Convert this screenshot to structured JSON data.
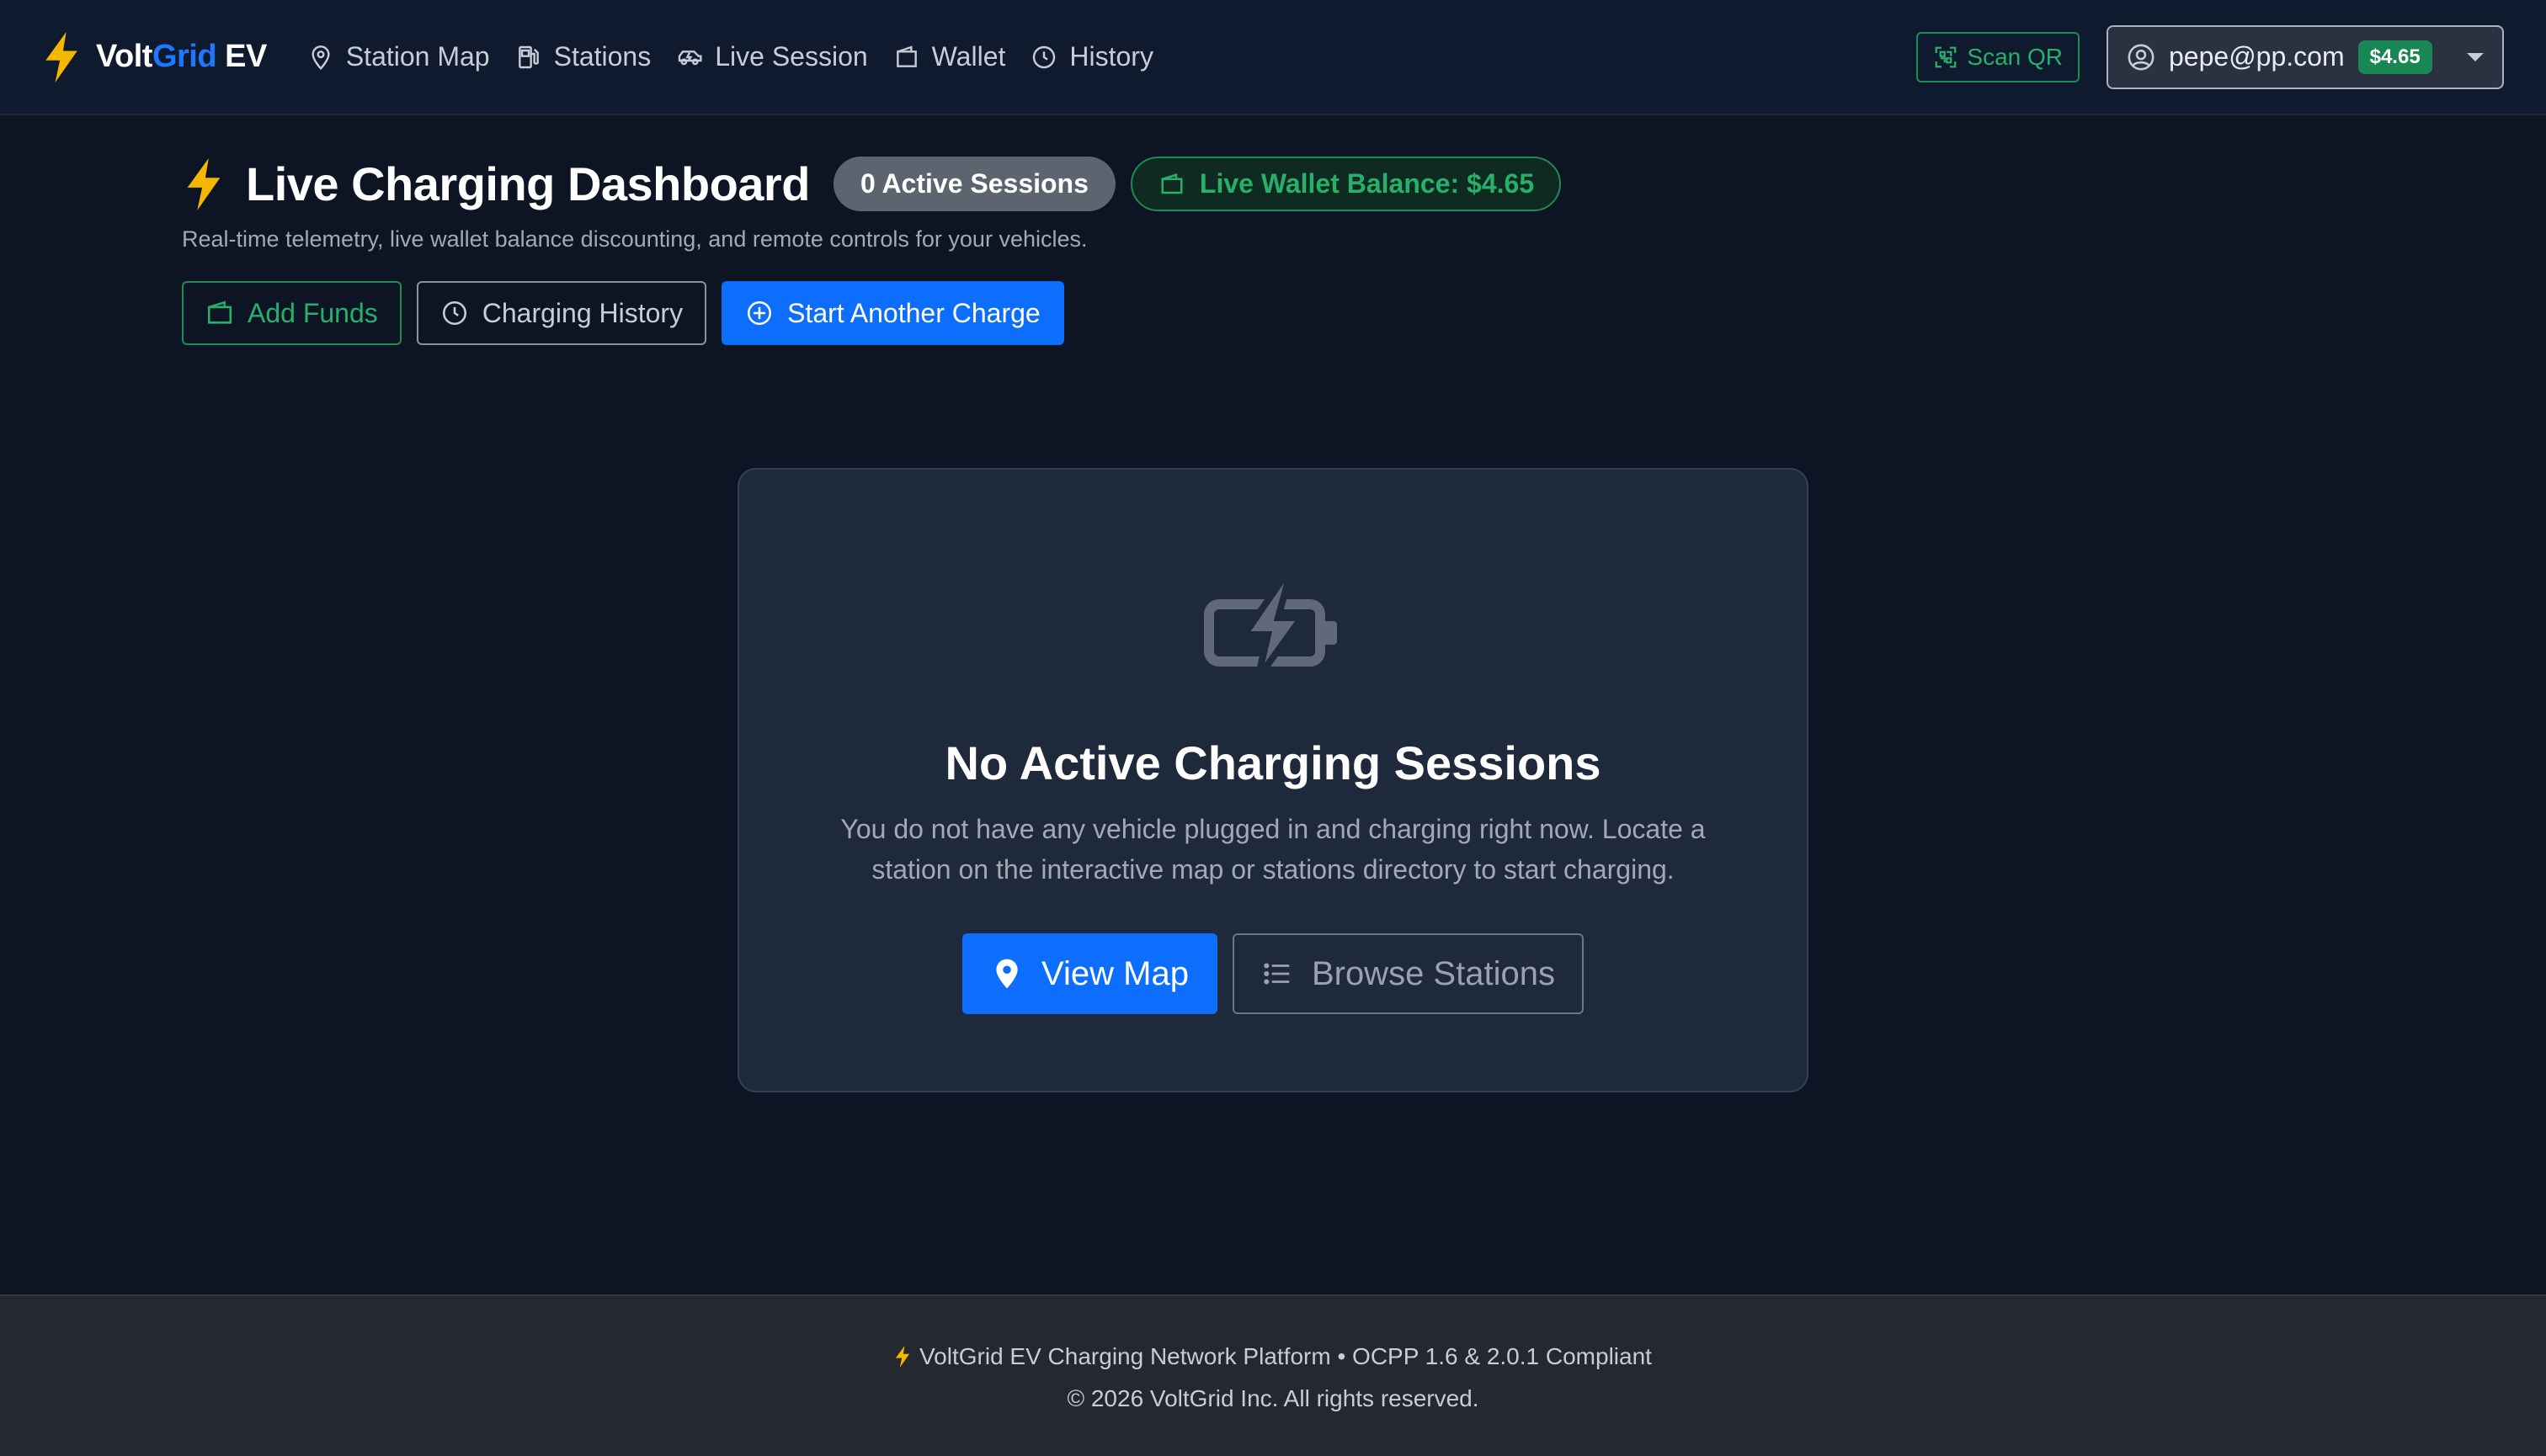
{
  "colors": {
    "accent": "#0d6efd",
    "success": "#198754",
    "brand_bolt": "#f5b800"
  },
  "brand": {
    "name_part1": "Volt",
    "name_part2": "Grid",
    "name_part3": " EV",
    "icon": "lightning-bolt-icon"
  },
  "nav": {
    "items": [
      {
        "label": "Station Map",
        "icon": "map-pin-icon"
      },
      {
        "label": "Stations",
        "icon": "fuel-pump-icon"
      },
      {
        "label": "Live Session",
        "icon": "ev-car-icon"
      },
      {
        "label": "Wallet",
        "icon": "wallet-icon"
      },
      {
        "label": "History",
        "icon": "clock-icon"
      }
    ],
    "scan_label": "Scan QR",
    "user_email": "pepe@pp.com",
    "user_balance": "$4.65"
  },
  "header": {
    "title": "Live Charging Dashboard",
    "active_sessions": "0 Active Sessions",
    "wallet_balance": "Live Wallet Balance: $4.65",
    "subtitle": "Real-time telemetry, live wallet balance discounting, and remote controls for your vehicles.",
    "actions": {
      "add_funds": "Add Funds",
      "history": "Charging History",
      "start_charge": "Start Another Charge"
    }
  },
  "empty_state": {
    "icon": "battery-charging-icon",
    "title": "No Active Charging Sessions",
    "text": "You do not have any vehicle plugged in and charging right now. Locate a station on the interactive map or stations directory to start charging.",
    "view_map": "View Map",
    "browse_stations": "Browse Stations"
  },
  "footer": {
    "line1": "VoltGrid EV Charging Network Platform • OCPP 1.6 & 2.0.1 Compliant",
    "line2": "© 2026 VoltGrid Inc. All rights reserved."
  }
}
